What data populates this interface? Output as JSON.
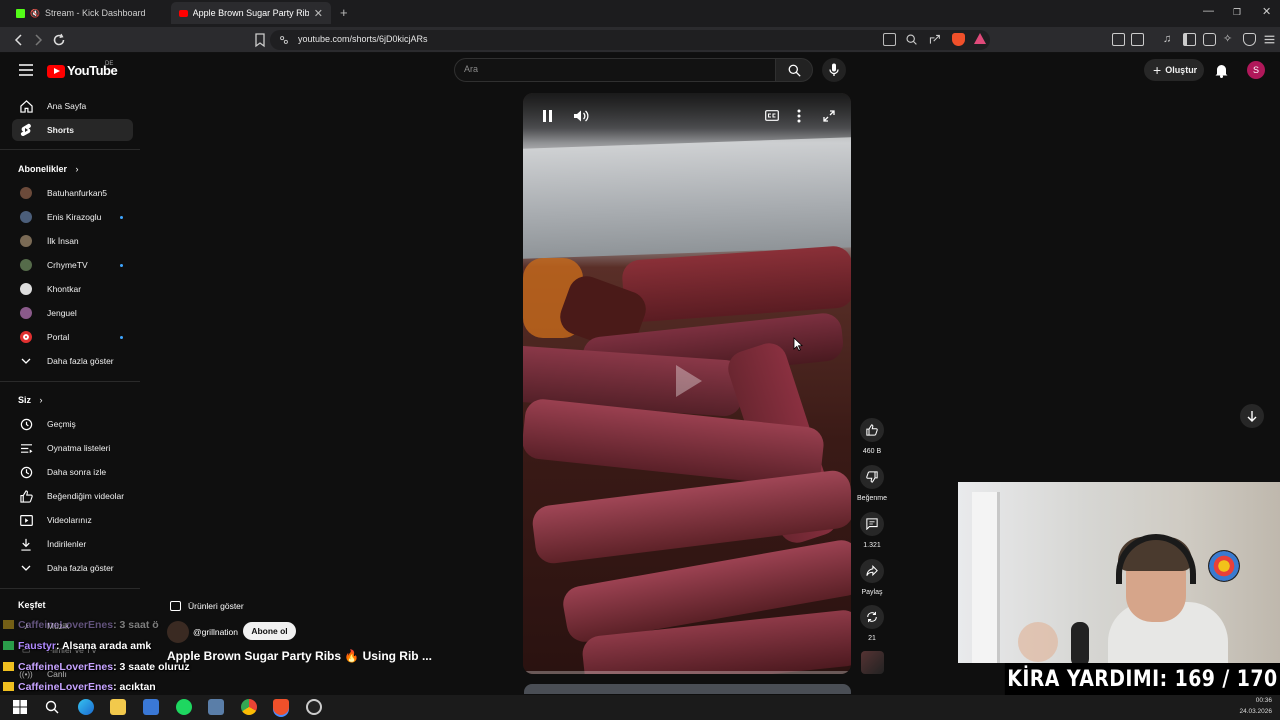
{
  "browser": {
    "tabs": [
      {
        "label": "Stream - Kick Dashboard",
        "active": false
      },
      {
        "label": "Apple Brown Sugar Party Ribs 🔥",
        "active": true
      }
    ],
    "url": "youtube.com/shorts/6jD0kicjARs"
  },
  "masthead": {
    "logo": "YouTube",
    "country": "DE",
    "search_placeholder": "Ara",
    "create_label": "Oluştur",
    "avatar_letter": "S"
  },
  "sidebar": {
    "main": [
      {
        "label": "Ana Sayfa",
        "icon": "home-icon"
      },
      {
        "label": "Shorts",
        "icon": "shorts-icon",
        "active": true
      }
    ],
    "subscriptions_title": "Abonelikler",
    "subscriptions": [
      {
        "label": "Batuhanfurkan5",
        "color": "#6b4a3a",
        "dot": false
      },
      {
        "label": "Enis Kirazoglu",
        "color": "#4b5e7a",
        "dot": true
      },
      {
        "label": "İlk İnsan",
        "color": "#7a6a55",
        "dot": false
      },
      {
        "label": "CrhymeTV",
        "color": "#556b4a",
        "dot": true
      },
      {
        "label": "Khontkar",
        "color": "#dddddd",
        "dot": false
      },
      {
        "label": "Jenguel",
        "color": "#8a5a8a",
        "dot": false
      },
      {
        "label": "Portal",
        "color": "#e03030",
        "dot": true
      }
    ],
    "show_more_1": "Daha fazla göster",
    "you_title": "Siz",
    "you": [
      {
        "label": "Geçmiş",
        "icon": "history-icon"
      },
      {
        "label": "Oynatma listeleri",
        "icon": "playlist-icon"
      },
      {
        "label": "Daha sonra izle",
        "icon": "clock-icon"
      },
      {
        "label": "Beğendiğim videolar",
        "icon": "thumbs-up-icon"
      },
      {
        "label": "Videolarınız",
        "icon": "video-icon"
      },
      {
        "label": "İndirilenler",
        "icon": "download-icon"
      }
    ],
    "show_more_2": "Daha fazla göster",
    "explore_title": "Keşfet",
    "explore": [
      {
        "label": "Müzik"
      },
      {
        "label": "Filmler ve TV"
      },
      {
        "label": "Canlı"
      }
    ]
  },
  "shorts": {
    "products_label": "Ürünleri göster",
    "channel": "@grillnation",
    "subscribe_label": "Abone ol",
    "title": "Apple Brown Sugar Party Ribs 🔥 Using Rib ...",
    "actions": {
      "likes": "460 B",
      "dislike_label": "Beğenme",
      "comments": "1.321",
      "share_label": "Paylaş",
      "remix_count": "21"
    }
  },
  "chat": [
    {
      "user": "CaffeineLoverEnes",
      "msg": ": 3 saat ö",
      "faded": true
    },
    {
      "user": "Faustyr",
      "msg": ": Alsana arada amk",
      "faded": false
    },
    {
      "user": "CaffeineLoverEnes",
      "msg": ": 3 saate oluruz",
      "faded": false
    },
    {
      "user": "CaffeineLoverEnes",
      "msg": ": acıktan",
      "faded": false
    }
  ],
  "overlay": {
    "goal_text": "KİRA YARDIMI: 169 / 170"
  },
  "taskbar": {
    "time": "00:36",
    "date": "24.03.2026"
  }
}
